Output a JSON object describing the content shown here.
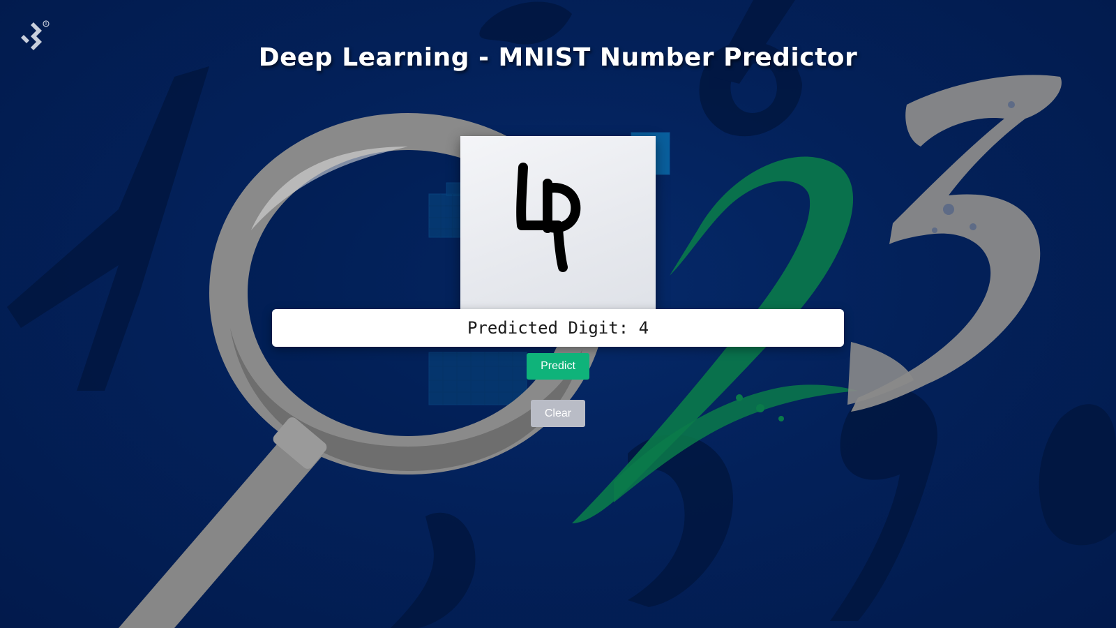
{
  "page": {
    "title": "Deep Learning - MNIST Number Predictor"
  },
  "result": {
    "label": "Predicted Digit: ",
    "value": "4"
  },
  "buttons": {
    "predict_label": "Predict",
    "clear_label": "Clear"
  },
  "colors": {
    "background": "#02194d",
    "predict_button": "#0fb37a",
    "clear_button": "#b9bcc6",
    "accent_green": "#0a7a4a",
    "magnifier_gray": "#8a8a8a"
  },
  "icons": {
    "logo": "toptal-logo-icon",
    "registered": "®"
  }
}
